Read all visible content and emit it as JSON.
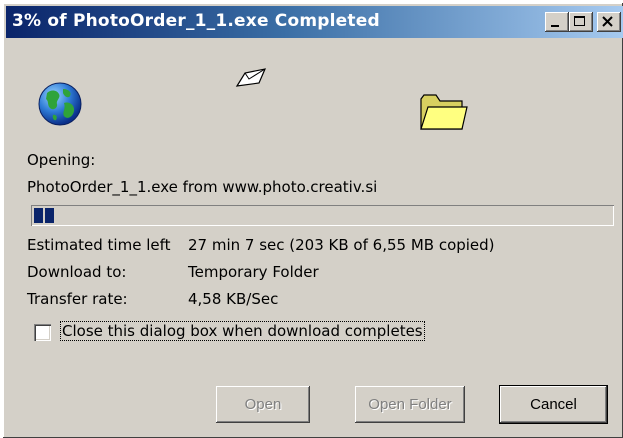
{
  "window": {
    "title": "3% of PhotoOrder_1_1.exe Completed",
    "controls": [
      "minimize-icon",
      "maximize-icon",
      "close-icon"
    ]
  },
  "animation": {
    "source_icon": "globe-icon",
    "document_icon": "flying-document-icon",
    "target_icon": "folder-icon"
  },
  "status": {
    "opening_label": "Opening:",
    "file_line": "PhotoOrder_1_1.exe from www.photo.creativ.si",
    "progress_percent": 3
  },
  "details": {
    "time_left_label": "Estimated time left",
    "time_left_value": "27 min 7 sec (203 KB of 6,55 MB copied)",
    "download_to_label": "Download to:",
    "download_to_value": "Temporary Folder",
    "transfer_rate_label": "Transfer rate:",
    "transfer_rate_value": "4,58 KB/Sec"
  },
  "options": {
    "close_when_done_label": "Close this dialog box when download completes",
    "close_when_done_checked": false
  },
  "buttons": {
    "open": "Open",
    "open_folder": "Open Folder",
    "cancel": "Cancel"
  },
  "colors": {
    "title_gradient_start": "#0a246a",
    "title_gradient_end": "#a6caf0",
    "progress_fill": "#0a246a",
    "dialog_face": "#d4d0c8"
  }
}
